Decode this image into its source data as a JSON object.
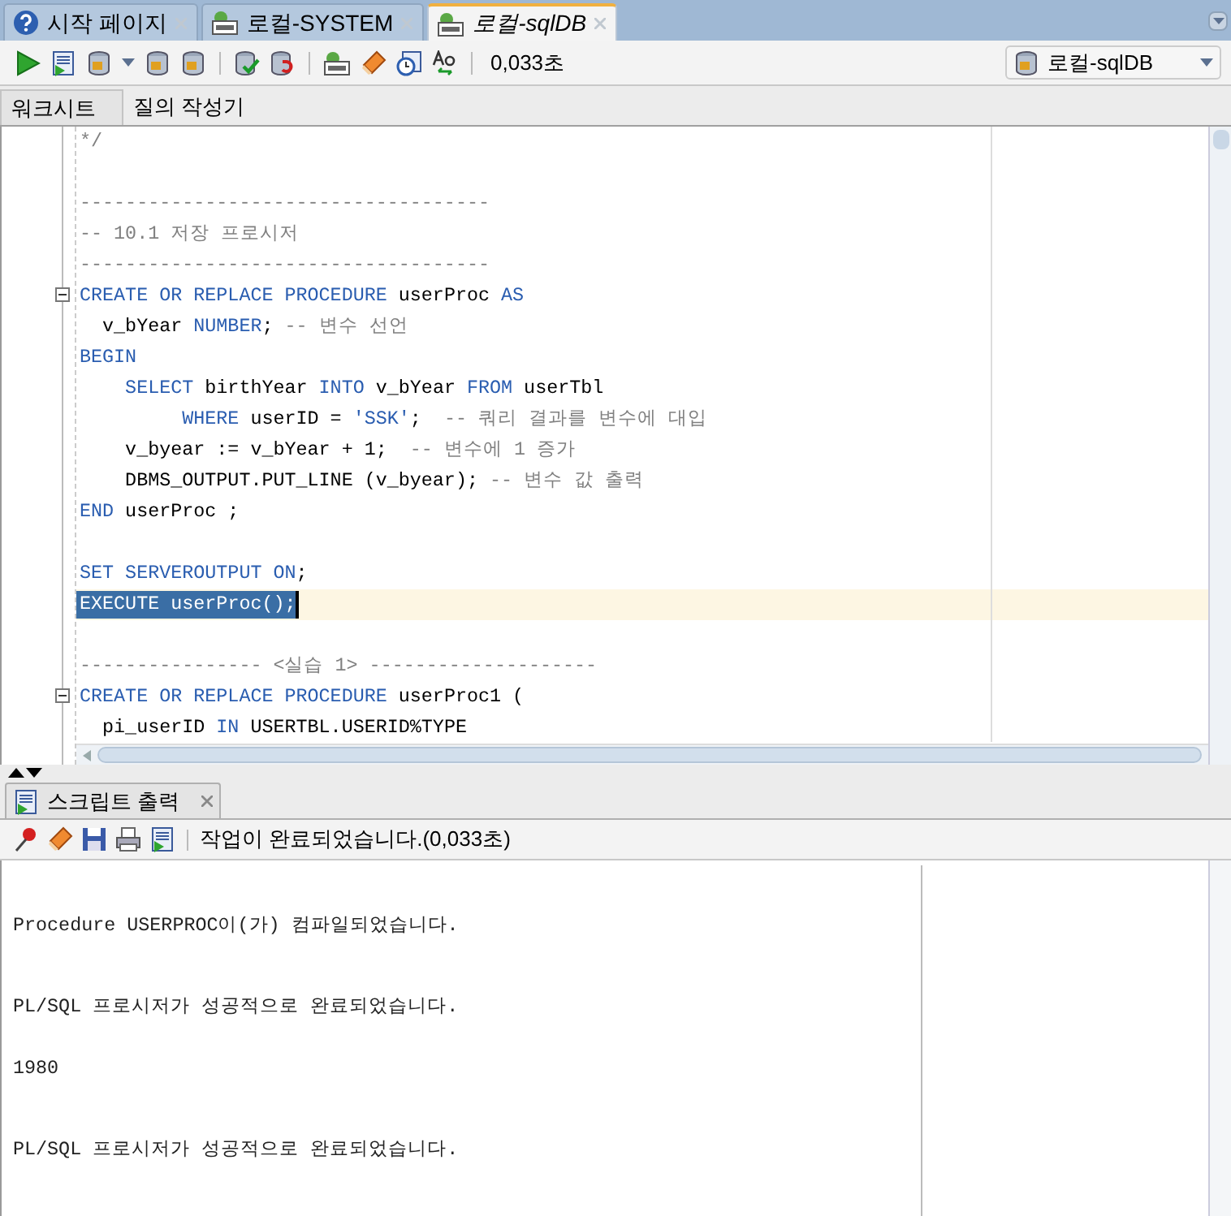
{
  "doc_tabs": [
    {
      "label": "시작 페이지",
      "selected": false
    },
    {
      "label": "로컬-SYSTEM",
      "selected": false
    },
    {
      "label": "로컬-sqlDB",
      "selected": true
    }
  ],
  "toolbar": {
    "elapsed": "0,033초",
    "connection": "로컬-sqlDB"
  },
  "sub_tabs": [
    {
      "label": "워크시트",
      "selected": true
    },
    {
      "label": "질의 작성기",
      "selected": false
    }
  ],
  "code_lines": [
    {
      "tokens": [
        {
          "kind": "comment",
          "text": "*/"
        }
      ]
    },
    {
      "gap_before": true,
      "tokens": [
        {
          "kind": "comment",
          "text": "------------------------------------"
        }
      ]
    },
    {
      "tokens": [
        {
          "kind": "comment",
          "text": "-- 10.1 저장 프로시저"
        }
      ]
    },
    {
      "tokens": [
        {
          "kind": "comment",
          "text": "------------------------------------"
        }
      ]
    },
    {
      "fold": true,
      "tokens": [
        {
          "kind": "keyword",
          "text": "CREATE OR REPLACE PROCEDURE"
        },
        {
          "kind": "plain",
          "text": " userProc "
        },
        {
          "kind": "keyword",
          "text": "AS"
        }
      ]
    },
    {
      "tokens": [
        {
          "kind": "plain",
          "text": "  v_bYear "
        },
        {
          "kind": "keyword",
          "text": "NUMBER"
        },
        {
          "kind": "plain",
          "text": "; "
        },
        {
          "kind": "comment",
          "text": "-- 변수 선언"
        }
      ]
    },
    {
      "tokens": [
        {
          "kind": "keyword",
          "text": "BEGIN"
        }
      ]
    },
    {
      "tokens": [
        {
          "kind": "keyword",
          "text": "    SELECT"
        },
        {
          "kind": "plain",
          "text": " birthYear "
        },
        {
          "kind": "keyword",
          "text": "INTO"
        },
        {
          "kind": "plain",
          "text": " v_bYear "
        },
        {
          "kind": "keyword",
          "text": "FROM"
        },
        {
          "kind": "plain",
          "text": " userTbl"
        }
      ]
    },
    {
      "tokens": [
        {
          "kind": "keyword",
          "text": "         WHERE"
        },
        {
          "kind": "plain",
          "text": " userID = "
        },
        {
          "kind": "string",
          "text": "'SSK'"
        },
        {
          "kind": "plain",
          "text": ";  "
        },
        {
          "kind": "comment",
          "text": "-- 쿼리 결과를 변수에 대입"
        }
      ]
    },
    {
      "tokens": [
        {
          "kind": "plain",
          "text": "    v_byear := v_bYear + "
        },
        {
          "kind": "number",
          "text": "1"
        },
        {
          "kind": "plain",
          "text": ";  "
        },
        {
          "kind": "comment",
          "text": "-- 변수에 1 증가"
        }
      ]
    },
    {
      "tokens": [
        {
          "kind": "plain",
          "text": "    DBMS_OUTPUT.PUT_LINE (v_byear); "
        },
        {
          "kind": "comment",
          "text": "-- 변수 값 출력"
        }
      ]
    },
    {
      "tokens": [
        {
          "kind": "keyword",
          "text": "END"
        },
        {
          "kind": "plain",
          "text": " userProc ;"
        }
      ]
    },
    {
      "gap_before": true,
      "tokens": [
        {
          "kind": "keyword",
          "text": "SET SERVEROUTPUT ON"
        },
        {
          "kind": "plain",
          "text": ";"
        }
      ]
    },
    {
      "selected": true,
      "tokens": [
        {
          "kind": "keyword",
          "text": "EXECUTE"
        },
        {
          "kind": "plain",
          "text": " userProc();"
        }
      ]
    },
    {
      "gap_before": true,
      "tokens": [
        {
          "kind": "comment",
          "text": "---------------- <실습 1> --------------------"
        }
      ]
    },
    {
      "fold": true,
      "tokens": [
        {
          "kind": "keyword",
          "text": "CREATE OR REPLACE PROCEDURE"
        },
        {
          "kind": "plain",
          "text": " userProc1 ("
        }
      ]
    },
    {
      "tokens": [
        {
          "kind": "plain",
          "text": "  pi_userID "
        },
        {
          "kind": "keyword",
          "text": "IN"
        },
        {
          "kind": "plain",
          "text": " USERTBL.USERID%TYPE"
        }
      ]
    }
  ],
  "output_panel": {
    "tab": "스크립트 출력",
    "status": "작업이 완료되었습니다.(0,033초)",
    "lines": [
      {
        "kind": "message",
        "text": "Procedure USERPROC이(가) 컴파일되었습니다."
      },
      {
        "kind": "message",
        "text": "PL/SQL 프로시저가 성공적으로 완료되었습니다."
      },
      {
        "kind": "value",
        "text": "1980"
      },
      {
        "kind": "message",
        "text": "PL/SQL 프로시저가 성공적으로 완료되었습니다."
      }
    ]
  }
}
